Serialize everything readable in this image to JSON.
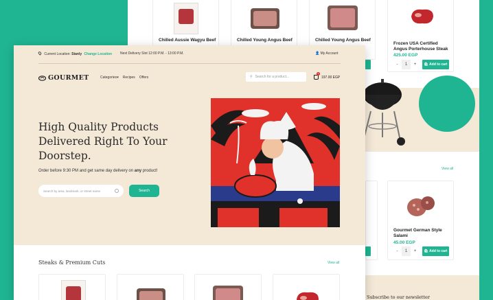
{
  "back_page": {
    "products_top": [
      {
        "name": "Chilled Aussie Wagyu Beef"
      },
      {
        "name": "Chilled Young Angus Beef"
      },
      {
        "name": "Chilled Young Angus Beef"
      },
      {
        "name": "Frozen USA Certified Angus Porterhouse Steak",
        "price": "425.00 EGP",
        "qty": "1",
        "add_label": "Add to cart"
      }
    ],
    "view_all_1": "View all",
    "view_all_2": "View all",
    "products_mid": [
      {
        "name": "Gourmet German Style Salami",
        "price": "45.00 EGP",
        "qty": "1",
        "add_label": "Add to cart"
      }
    ],
    "newsletter": "Subscribe to our newsletter"
  },
  "front_page": {
    "topbar": {
      "location_label": "Current Location:",
      "location_value": "Stanly",
      "change_location": "Change Location",
      "delivery": "Next Delivery Slot 12:00 P.M. - 13:00 P.M.",
      "account": "My Account"
    },
    "logo": "GOURMET",
    "nav": {
      "categories": "Categories",
      "recipes": "Recipes",
      "offers": "Offers"
    },
    "search_placeholder": "Search for a product...",
    "cart_total": "197.00 EGP",
    "cart_count": "1",
    "hero": {
      "headline": "High Quality Products Delivered Right To Your Doorstep.",
      "sub_before": "Order before 9:30 PM and get same day delivery on ",
      "sub_bold": "any",
      "sub_after": " product!",
      "address_placeholder": "Search by area, landmark, or street name",
      "search_button": "Search"
    },
    "section_title": "Steaks & Premium Cuts",
    "view_all": "View all"
  },
  "colors": {
    "accent": "#1fb592",
    "hero_bg": "#f4e8d7",
    "art_red": "#e0312a"
  }
}
